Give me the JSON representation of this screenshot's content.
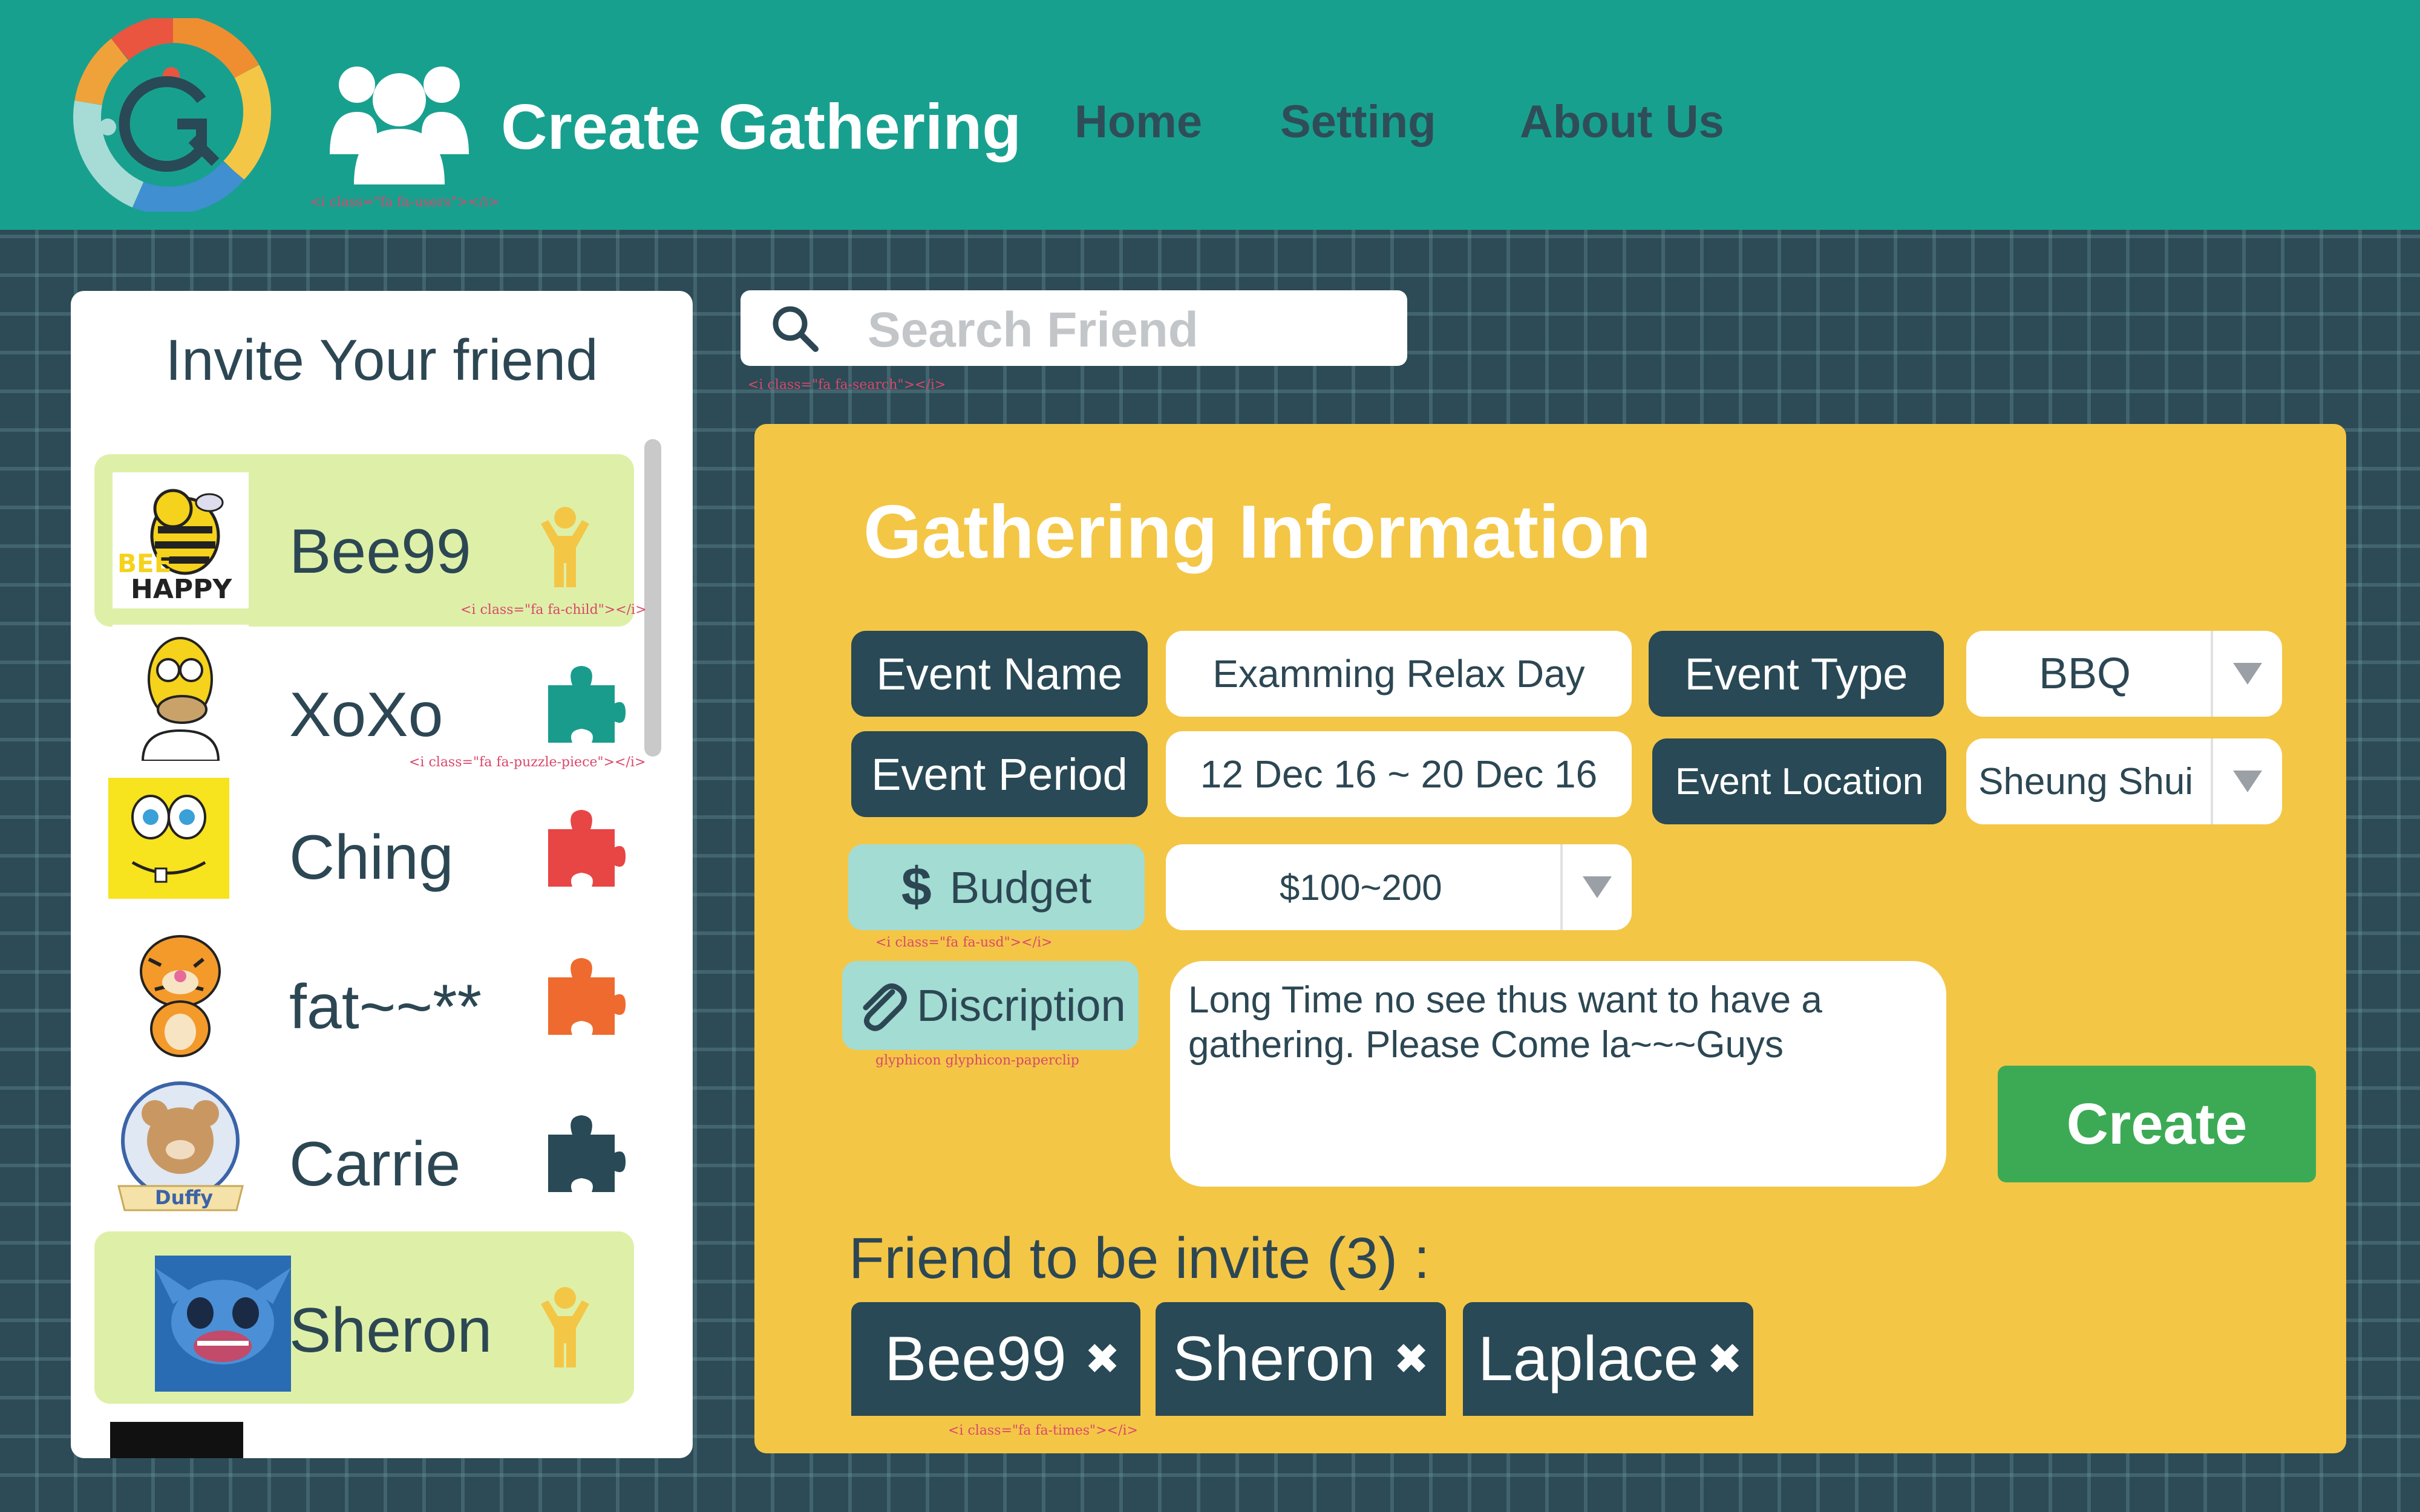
{
  "header": {
    "app_title": "Create Gathering",
    "nav": [
      "Home",
      "Setting",
      "About Us"
    ],
    "users_icon_note": "<i class=\"fa fa-users\"></i>"
  },
  "search": {
    "placeholder": "Search Friend",
    "icon_note": "<i class=\"fa fa-search\"></i>"
  },
  "invite_panel": {
    "title": "Invite Your friend",
    "friends": [
      {
        "name": "Bee99",
        "icon": "child-icon",
        "selected": true,
        "note": "<i class=\"fa fa-child\"></i>"
      },
      {
        "name": "XoXo",
        "icon": "puzzle-piece-icon",
        "selected": false,
        "note": "<i class=\"fa fa-puzzle-piece\"></i>"
      },
      {
        "name": "Ching",
        "icon": "puzzle-piece-icon",
        "selected": false
      },
      {
        "name": "fat~~**",
        "icon": "puzzle-piece-icon",
        "selected": false
      },
      {
        "name": "Carrie",
        "icon": "puzzle-piece-icon",
        "selected": false
      },
      {
        "name": "Sheron",
        "icon": "child-icon",
        "selected": true
      }
    ]
  },
  "form": {
    "title": "Gathering Information",
    "event_name_label": "Event Name",
    "event_name_value": "Examming Relax Day",
    "event_type_label": "Event Type",
    "event_type_value": "BBQ",
    "event_period_label": "Event Period",
    "event_period_value": "12 Dec 16 ~ 20 Dec 16",
    "event_location_label": "Event Location",
    "event_location_value": "Sheung Shui",
    "budget_label": "Budget",
    "budget_value": "$100~200",
    "budget_note": "<i class=\"fa fa-usd\"></i>",
    "description_label": "Discription",
    "description_value": "Long Time no see thus want to  have a gathering. Please Come la~~~Guys",
    "description_note": "glyphicon glyphicon-paperclip",
    "create_label": "Create",
    "invite_label": "Friend to be invite (3) :",
    "invited": [
      "Bee99",
      "Sheron",
      "Laplace"
    ],
    "chip_note": "<i class=\"fa fa-times\"></i>"
  },
  "colors": {
    "header": "#18a08f",
    "background": "#2c4b56",
    "panel": "#f4c646",
    "label": "#284955",
    "selected": "#def0a8",
    "create": "#3caa55",
    "child_icon": "#f4c646",
    "puzzle_colors": [
      "#1a9c8c",
      "#e84545",
      "#ef6a2e",
      "#284955"
    ]
  }
}
